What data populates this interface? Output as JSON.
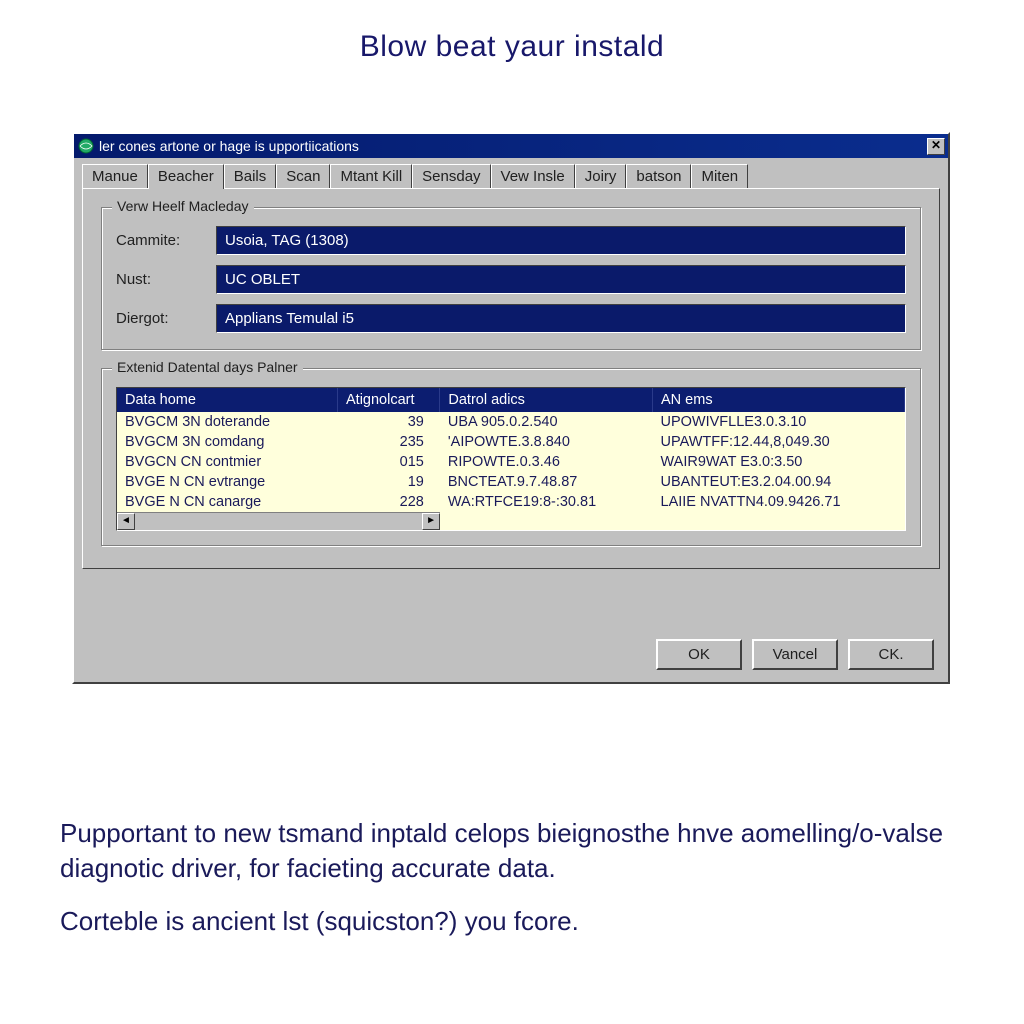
{
  "page_title": "Blow beat yaur instald",
  "window": {
    "title": "ler cones artone or hage is upportiications"
  },
  "tabs": [
    "Manue",
    "Beacher",
    "Bails",
    "Scan",
    "Mtant Kill",
    "Sensday",
    "Vew Insle",
    "Joiry",
    "batson",
    "Miten"
  ],
  "active_tab_index": 1,
  "group1": {
    "legend": "Verw Heelf Macleday",
    "rows": [
      {
        "label": "Cammite:",
        "value": "Usoia, TAG (1308)"
      },
      {
        "label": "Nust:",
        "value": "UC OBLET"
      },
      {
        "label": "Diergot:",
        "value": "Applians Temulal i5"
      }
    ]
  },
  "group2": {
    "legend": "Extenid Datental days Palner",
    "headers": [
      "Data home",
      "Atignolcart",
      "Datrol adics",
      "AN ems"
    ],
    "rows": [
      {
        "c0": "BVGCM 3N doterande",
        "c1": "39",
        "c2": "UBA 905.0.2.540",
        "c3": "UPOWIVFLLE3.0.3.10"
      },
      {
        "c0": "BVGCM 3N comdang",
        "c1": "235",
        "c2": "'AIPOWTE.3.8.840",
        "c3": "UPAWTFF:12.44,8,049.30"
      },
      {
        "c0": "BVGCN CN contmier",
        "c1": "015",
        "c2": "RIPOWTE.0.3.46",
        "c3": "WAIR9WAT E3.0:3.50"
      },
      {
        "c0": "BVGE N CN evtrange",
        "c1": "19",
        "c2": "BNCTEAT.9.7.48.87",
        "c3": "UBANTEUT:E3.2.04.00.94"
      },
      {
        "c0": "BVGE N CN canarge",
        "c1": "228",
        "c2": "WA:RTFCE19:8-:30.81",
        "c3": "LAIIE NVATTN4.09.9426.71"
      }
    ]
  },
  "buttons": {
    "ok": "OK",
    "cancel": "Vancel",
    "ck": "CK."
  },
  "body_copy": {
    "p1": "Pupportant to new tsmand inptald celops bieignosthe hnve aomelling/o-valse diagnotic driver, for facieting accurate data.",
    "p2": "Corteble is ancient lst (squicston?) you fcore."
  }
}
